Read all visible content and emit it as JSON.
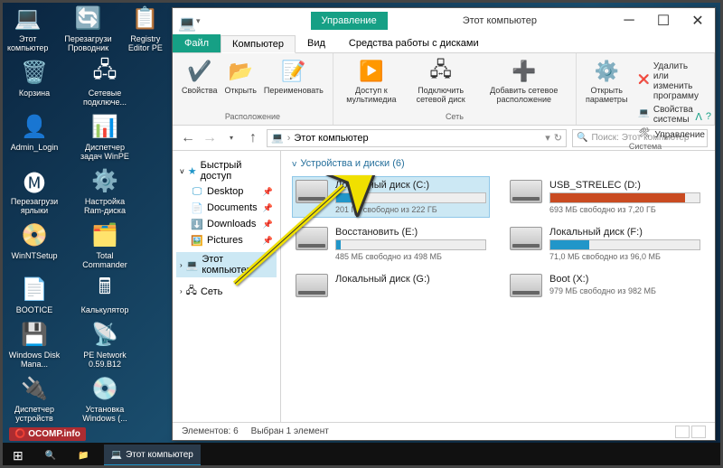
{
  "desktop_icons": [
    [
      {
        "label": "Этот компьютер",
        "icon": "💻"
      },
      {
        "label": "Перезагрузи Проводник",
        "icon": "🔄"
      },
      {
        "label": "Registry Editor PE",
        "icon": "📋"
      }
    ],
    [
      {
        "label": "Корзина",
        "icon": "🗑️"
      },
      {
        "label": "Сетевые подключе...",
        "icon": "🖧"
      }
    ],
    [
      {
        "label": "Admin_Login",
        "icon": "👤"
      },
      {
        "label": "Диспетчер задач WinPE",
        "icon": "📊"
      }
    ],
    [
      {
        "label": "Перезагрузи ярлыки",
        "icon": "🅜"
      },
      {
        "label": "Настройка Ram-диска",
        "icon": "⚙️"
      }
    ],
    [
      {
        "label": "WinNTSetup",
        "icon": "📀"
      },
      {
        "label": "Total Commander",
        "icon": "🗂️"
      }
    ],
    [
      {
        "label": "BOOTICE",
        "icon": "📄"
      },
      {
        "label": "Калькулятор",
        "icon": "🖩"
      }
    ],
    [
      {
        "label": "Windows Disk Mana...",
        "icon": "💾"
      },
      {
        "label": "PE Network 0.59.B12",
        "icon": "📡"
      }
    ],
    [
      {
        "label": "Диспетчер устройств",
        "icon": "🔌"
      },
      {
        "label": "Установка Windows (...",
        "icon": "💿"
      }
    ]
  ],
  "window": {
    "context_tab": "Управление",
    "title": "Этот компьютер",
    "tabs": {
      "file": "Файл",
      "computer": "Компьютер",
      "view": "Вид",
      "tools": "Средства работы с дисками"
    },
    "ribbon": {
      "g1": {
        "items": [
          {
            "l": "Свойства",
            "i": "✔️"
          },
          {
            "l": "Открыть",
            "i": "📂"
          },
          {
            "l": "Переименовать",
            "i": "📝"
          }
        ],
        "label": "Расположение"
      },
      "g2": {
        "items": [
          {
            "l": "Доступ к мультимедиа",
            "i": "▶️"
          },
          {
            "l": "Подключить сетевой диск",
            "i": "🖧"
          },
          {
            "l": "Добавить сетевое расположение",
            "i": "➕"
          }
        ],
        "label": "Сеть"
      },
      "g3": {
        "big": {
          "l": "Открыть параметры",
          "i": "⚙️"
        },
        "small": [
          {
            "l": "Удалить или изменить программу",
            "i": "❌"
          },
          {
            "l": "Свойства системы",
            "i": "💻"
          },
          {
            "l": "Управление",
            "i": "🛠"
          }
        ],
        "label": "Система"
      }
    },
    "breadcrumb": {
      "icon": "💻",
      "text": "Этот компьютер"
    },
    "search_placeholder": "Поиск: Этот компьютер",
    "sidebar": {
      "quick": "Быстрый доступ",
      "items": [
        {
          "l": "Desktop"
        },
        {
          "l": "Documents"
        },
        {
          "l": "Downloads"
        },
        {
          "l": "Pictures"
        }
      ],
      "this_pc": "Этот компьютер",
      "network": "Сеть"
    },
    "content_header": "Устройства и диски (6)",
    "drives": [
      {
        "name": "Локальный диск (C:)",
        "free": "201 ГБ свободно из 222 ГБ",
        "pct": 10,
        "sel": true,
        "bar": true
      },
      {
        "name": "USB_STRELEC (D:)",
        "free": "693 МБ свободно из 7,20 ГБ",
        "pct": 90,
        "bar": true,
        "red": true
      },
      {
        "name": "Восстановить (E:)",
        "free": "485 МБ свободно из 498 МБ",
        "pct": 3,
        "bar": true
      },
      {
        "name": "Локальный диск (F:)",
        "free": "71,0 МБ свободно из 96,0 МБ",
        "pct": 26,
        "bar": true
      },
      {
        "name": "Локальный диск (G:)",
        "free": "",
        "bar": false
      },
      {
        "name": "Boot (X:)",
        "free": "979 МБ свободно из 982 МБ",
        "bar": false
      }
    ],
    "status": {
      "count": "Элементов: 6",
      "sel": "Выбран 1 элемент"
    }
  },
  "taskbar": {
    "active": "Этот компьютер"
  },
  "watermark": "OCOMP.info"
}
